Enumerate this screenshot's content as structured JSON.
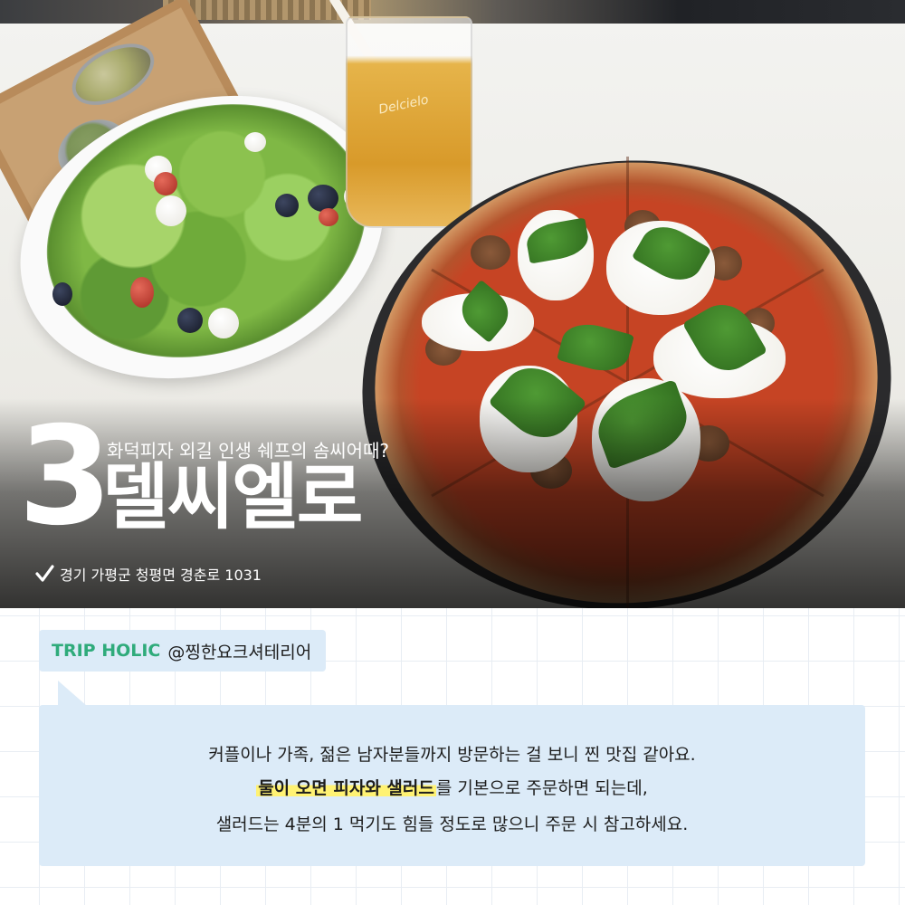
{
  "photo": {
    "glass_label": "Delcielo"
  },
  "overlay": {
    "number": "3",
    "subtitle": "화덕피자 외길 인생 쉐프의 솜씨어때?",
    "title": "델씨엘로",
    "location": "경기 가평군 청평면 경춘로 1031"
  },
  "author": {
    "brand": "TRIP HOLIC",
    "handle": "@찡한요크셔테리어"
  },
  "review": {
    "line1": "커플이나 가족, 젊은 남자분들까지 방문하는 걸 보니 찐 맛집 같아요.",
    "line2_highlight": "둘이 오면 피자와 샐러드",
    "line2_rest": "를 기본으로 주문하면 되는데,",
    "line3": "샐러드는 4분의 1 먹기도 힘들 정도로 많으니 주문 시 참고하세요."
  },
  "colors": {
    "brand_green": "#2fab7b",
    "bubble_bg": "#dcebf8",
    "highlight": "#fff273"
  }
}
